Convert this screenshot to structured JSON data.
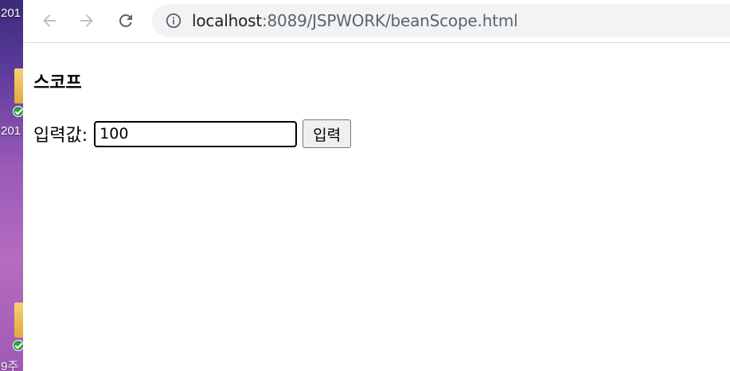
{
  "desktop": {
    "icon_labels": [
      "201",
      "201",
      "9주"
    ]
  },
  "browser": {
    "url_host": "localhost",
    "url_rest": ":8089/JSPWORK/beanScope.html",
    "icons": {
      "back": "arrow-left-icon",
      "forward": "arrow-right-icon",
      "reload": "reload-icon",
      "site_info": "info-circle-icon"
    }
  },
  "page": {
    "heading": "스코프",
    "input_label": "입력값:",
    "input_value": "100",
    "submit_label": "입력"
  },
  "colors": {
    "toolbar_bg": "#ffffff",
    "omnibox_bg": "#f1f3f4",
    "icon_gray": "#5f6368",
    "icon_disabled": "#bdc1c6"
  }
}
